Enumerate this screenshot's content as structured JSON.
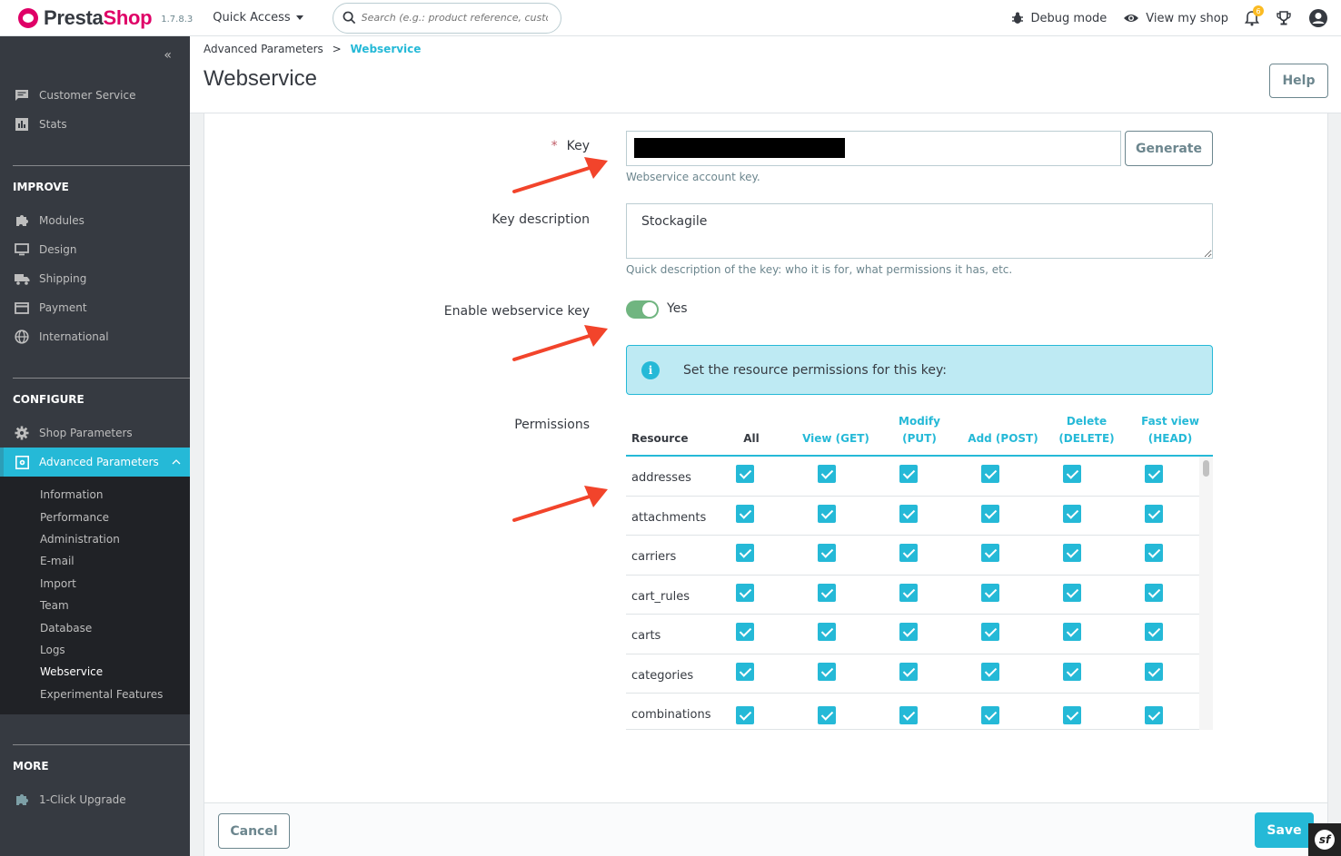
{
  "header": {
    "brand_main": "Presta",
    "brand_accent": "Shop",
    "version": "1.7.8.3",
    "quick_access": "Quick Access",
    "search_placeholder": "Search (e.g.: product reference, custon",
    "debug_mode": "Debug mode",
    "view_shop": "View my shop",
    "notification_count": "6"
  },
  "sidebar": {
    "top_items": [
      {
        "label": "Customer Service",
        "icon": "chat-icon"
      },
      {
        "label": "Stats",
        "icon": "bar-chart-icon"
      }
    ],
    "improve_title": "IMPROVE",
    "improve_items": [
      {
        "label": "Modules",
        "icon": "puzzle-icon"
      },
      {
        "label": "Design",
        "icon": "monitor-icon"
      },
      {
        "label": "Shipping",
        "icon": "truck-icon"
      },
      {
        "label": "Payment",
        "icon": "credit-card-icon"
      },
      {
        "label": "International",
        "icon": "globe-icon"
      }
    ],
    "configure_title": "CONFIGURE",
    "configure_items": [
      {
        "label": "Shop Parameters",
        "icon": "gear-icon"
      },
      {
        "label": "Advanced Parameters",
        "icon": "settings-box-icon"
      }
    ],
    "sub_items": [
      "Information",
      "Performance",
      "Administration",
      "E-mail",
      "Import",
      "Team",
      "Database",
      "Logs",
      "Webservice",
      "Experimental Features"
    ],
    "more_title": "MORE",
    "more_items": [
      {
        "label": "1-Click Upgrade",
        "icon": "puzzle-icon"
      }
    ]
  },
  "page": {
    "breadcrumb_parent": "Advanced Parameters",
    "breadcrumb_sep": ">",
    "breadcrumb_current": "Webservice",
    "title": "Webservice",
    "help": "Help"
  },
  "form": {
    "key_required": "*",
    "key_label": "Key",
    "generate": "Generate",
    "key_help": "Webservice account key.",
    "desc_label": "Key description",
    "desc_value": "Stockagile",
    "desc_help": "Quick description of the key: who it is for, what permissions it has, etc.",
    "enable_label": "Enable webservice key",
    "enable_value": "Yes",
    "info_text": "Set the resource permissions for this key:",
    "permissions_label": "Permissions"
  },
  "permissions": {
    "headers": {
      "resource": "Resource",
      "all": "All",
      "view_1": "View (GET)",
      "modify_1": "Modify",
      "modify_2": "(PUT)",
      "add_1": "Add (POST)",
      "delete_1": "Delete",
      "delete_2": "(DELETE)",
      "fast_1": "Fast view",
      "fast_2": "(HEAD)"
    },
    "rows": [
      "addresses",
      "attachments",
      "carriers",
      "cart_rules",
      "carts",
      "categories",
      "combinations"
    ]
  },
  "footer": {
    "cancel": "Cancel",
    "save": "Save"
  },
  "colors": {
    "accent": "#25b9d7",
    "brand": "#df0067",
    "switch_on": "#70b580",
    "arrow": "#f2442b"
  }
}
